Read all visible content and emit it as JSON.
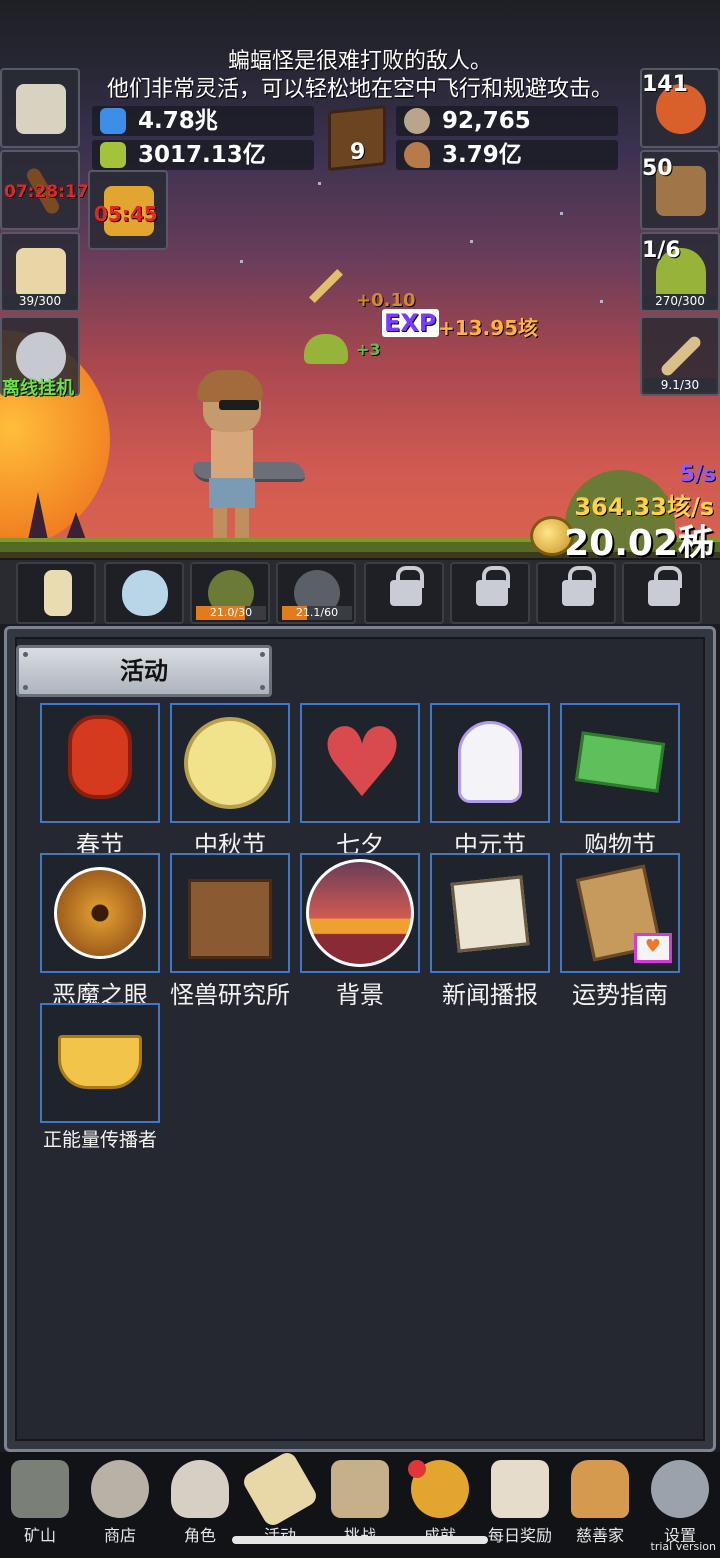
{
  "info": {
    "line1": "蝙蝠怪是很难打败的敌人。",
    "line2": "他们非常灵活，可以轻松地在空中飞行和规避攻击。"
  },
  "stats": {
    "blue_potion": "4.78兆",
    "green_potion": "3017.13亿",
    "coins": "92,765",
    "meat": "3.79亿",
    "book_count": "9"
  },
  "side_left": {
    "torch_timer": "07:28:17",
    "key_timer": "05:45",
    "beer_count": "39/300",
    "offline_label": "离线挂机"
  },
  "side_right": {
    "potion_count": "141",
    "chest_count": "50",
    "slime_count": "1/6",
    "slime_bar": "270/300",
    "sword_bar": "9.1/30"
  },
  "floats": {
    "gold_gain": "+0.10",
    "exp_label": "EXP",
    "exp_gain": "+13.95垓",
    "item_gain": "+3"
  },
  "rates": {
    "small": "5/s",
    "big": "364.33垓/s",
    "total": "20.02秭"
  },
  "pets": [
    {
      "bar": "21.0/30",
      "fill": 0.7
    },
    {
      "bar": "21.1/60",
      "fill": 0.35
    }
  ],
  "panel": {
    "tab_label": "活动",
    "activities": [
      {
        "label": "春节",
        "icon": "lantern-icon"
      },
      {
        "label": "中秋节",
        "icon": "moon-icon"
      },
      {
        "label": "七夕",
        "icon": "heart-icon"
      },
      {
        "label": "中元节",
        "icon": "ghost-icon"
      },
      {
        "label": "购物节",
        "icon": "cash-icon"
      },
      {
        "label": "恶魔之眼",
        "icon": "demon-eye-icon"
      },
      {
        "label": "怪兽研究所",
        "icon": "lab-icon"
      },
      {
        "label": "背景",
        "icon": "sunset-icon"
      },
      {
        "label": "新闻播报",
        "icon": "newspaper-icon"
      },
      {
        "label": "运势指南",
        "icon": "fortune-card-icon"
      },
      {
        "label": "正能量传播者",
        "icon": "crown-icon"
      }
    ]
  },
  "nav": [
    {
      "label": "矿山",
      "icon": "lantern-icon"
    },
    {
      "label": "商店",
      "icon": "ore-icon"
    },
    {
      "label": "角色",
      "icon": "skull-icon"
    },
    {
      "label": "活动",
      "icon": "scroll-icon"
    },
    {
      "label": "挑战",
      "icon": "map-icon"
    },
    {
      "label": "成就",
      "icon": "key-icon"
    },
    {
      "label": "每日奖励",
      "icon": "envelope-icon"
    },
    {
      "label": "慈善家",
      "icon": "bread-icon"
    },
    {
      "label": "设置",
      "icon": "gear-icon"
    }
  ],
  "trial": "trial version",
  "colors": {
    "accent_border": "#3f78c8",
    "exp_purple": "#7b3cff",
    "gold_yellow": "#ffd24a",
    "timer_red": "#e02828"
  }
}
